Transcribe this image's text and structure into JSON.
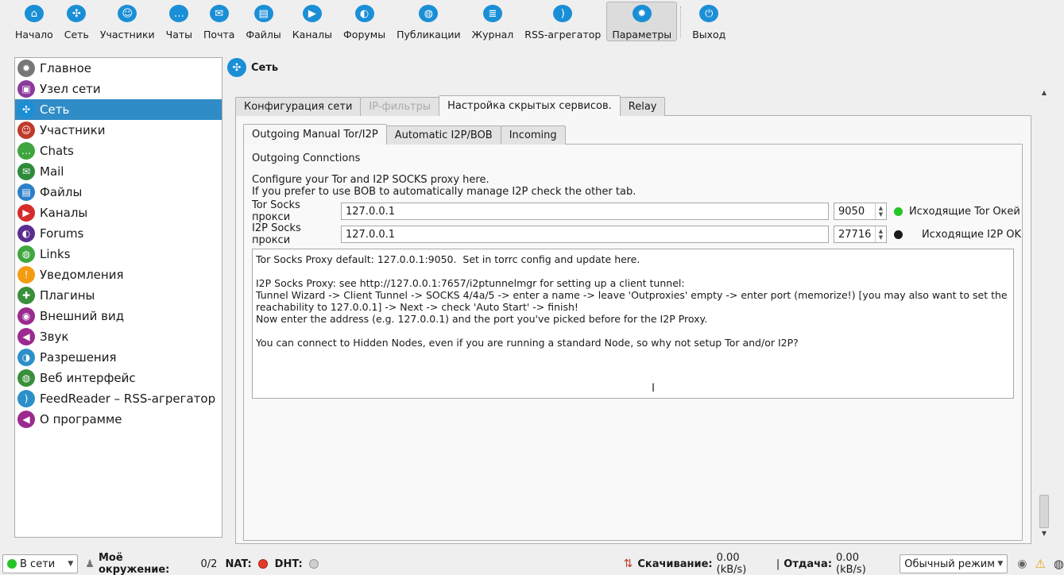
{
  "toolbar": {
    "items": [
      {
        "label": "Начало",
        "icon": "home-icon",
        "glyph": "⌂"
      },
      {
        "label": "Сеть",
        "icon": "network-icon",
        "glyph": "✣"
      },
      {
        "label": "Участники",
        "icon": "people-icon",
        "glyph": "☺"
      },
      {
        "label": "Чаты",
        "icon": "chat-icon",
        "glyph": "…"
      },
      {
        "label": "Почта",
        "icon": "mail-icon",
        "glyph": "✉"
      },
      {
        "label": "Файлы",
        "icon": "folder-icon",
        "glyph": "▤"
      },
      {
        "label": "Каналы",
        "icon": "channels-icon",
        "glyph": "▶"
      },
      {
        "label": "Форумы",
        "icon": "forums-icon",
        "glyph": "◐"
      },
      {
        "label": "Публикации",
        "icon": "globe-icon",
        "glyph": "◍"
      },
      {
        "label": "Журнал",
        "icon": "journal-icon",
        "glyph": "≣"
      },
      {
        "label": "RSS-агрегатор",
        "icon": "rss-icon",
        "glyph": ")"
      },
      {
        "label": "Параметры",
        "icon": "gear-icon",
        "glyph": "✹"
      },
      {
        "label": "Выход",
        "icon": "power-icon",
        "glyph": "⏻"
      }
    ]
  },
  "sidebar": {
    "items": [
      {
        "label": "Главное",
        "color": "#777777",
        "glyph": "✹"
      },
      {
        "label": "Узел сети",
        "color": "#8b3a9b",
        "glyph": "▣"
      },
      {
        "label": "Сеть",
        "color": "#1a8fd6",
        "glyph": "✣"
      },
      {
        "label": "Участники",
        "color": "#c0392b",
        "glyph": "☺"
      },
      {
        "label": "Chats",
        "color": "#3fa63f",
        "glyph": "…"
      },
      {
        "label": "Mail",
        "color": "#2e8b3a",
        "glyph": "✉"
      },
      {
        "label": "Файлы",
        "color": "#2c7fc9",
        "glyph": "▤"
      },
      {
        "label": "Каналы",
        "color": "#d62b2b",
        "glyph": "▶"
      },
      {
        "label": "Forums",
        "color": "#5a2d91",
        "glyph": "◐"
      },
      {
        "label": "Links",
        "color": "#3fa63f",
        "glyph": "◍"
      },
      {
        "label": "Уведомления",
        "color": "#f39c12",
        "glyph": "!"
      },
      {
        "label": "Плагины",
        "color": "#3a8f3a",
        "glyph": "✚"
      },
      {
        "label": "Внешний вид",
        "color": "#9b2a8e",
        "glyph": "◉"
      },
      {
        "label": "Звук",
        "color": "#9b2a8e",
        "glyph": "◀"
      },
      {
        "label": "Разрешения",
        "color": "#2c8fc9",
        "glyph": "◑"
      },
      {
        "label": "Веб интерфейс",
        "color": "#3a8f3a",
        "glyph": "◍"
      },
      {
        "label": "FeedReader – RSS-агрегатор",
        "color": "#2c8fc9",
        "glyph": ")"
      },
      {
        "label": "О программе",
        "color": "#9b2a8e",
        "glyph": "◀"
      }
    ],
    "selected_index": 2
  },
  "header": {
    "title": "Сеть"
  },
  "outer_tabs": [
    {
      "label": "Конфигурация сети",
      "state": "normal"
    },
    {
      "label": "IP-фильтры",
      "state": "disabled"
    },
    {
      "label": "Настройка скрытых сервисов.",
      "state": "active"
    },
    {
      "label": "Relay",
      "state": "normal"
    }
  ],
  "inner_tabs": [
    {
      "label": "Outgoing Manual Tor/I2P",
      "state": "active"
    },
    {
      "label": "Automatic I2P/BOB",
      "state": "normal"
    },
    {
      "label": "Incoming",
      "state": "normal"
    }
  ],
  "content": {
    "section_title": "Outgoing Connctions",
    "desc_line1": "Configure your Tor and I2P SOCKS proxy here.",
    "desc_line2": "If you prefer to use BOB to automatically manage I2P check the other tab.",
    "tor": {
      "label": "Tor Socks прокси",
      "host": "127.0.0.1",
      "port": "9050",
      "status": "Исходящие Tor Окей",
      "led_color": "#27c427"
    },
    "i2p": {
      "label": "I2P Socks прокси",
      "host": "127.0.0.1",
      "port": "27716",
      "status": "Исходящие I2P OK",
      "led_color": "#1a1a1a"
    },
    "info": {
      "p1": "Tor Socks Proxy default: 127.0.0.1:9050.  Set in torrc config and update here.",
      "p2": "I2P Socks Proxy: see http://127.0.0.1:7657/i2ptunnelmgr for setting up a client tunnel:\nTunnel Wizard -> Client Tunnel -> SOCKS 4/4a/5 -> enter a name -> leave 'Outproxies' empty -> enter port (memorize!) [you may also want to set the reachability to 127.0.0.1] -> Next -> check 'Auto Start' -> finish!\nNow enter the address (e.g. 127.0.0.1) and the port you've picked before for the I2P Proxy.",
      "p3": "You can connect to Hidden Nodes, even if you are running a standard Node, so why not setup Tor and/or I2P?"
    }
  },
  "statusbar": {
    "online_status": "В сети",
    "neighbors_label": "Моё окружение:",
    "neighbors_value": "0/2",
    "nat_label": "NAT:",
    "dht_label": "DHT:",
    "download_label": "Скачивание:",
    "download_value": "0.00 (kB/s)",
    "separator": "|",
    "upload_label": "Отдача:",
    "upload_value": "0.00 (kB/s)",
    "mode": "Обычный режим"
  }
}
